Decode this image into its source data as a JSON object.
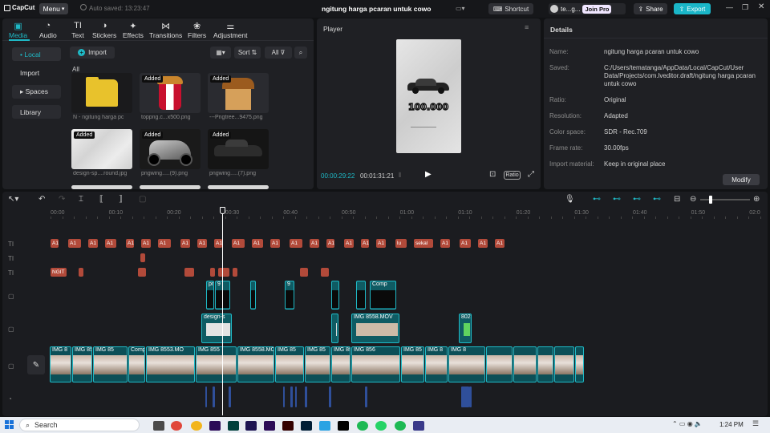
{
  "app": {
    "logo": "CapCut",
    "menu": "Menu",
    "autosave": "Auto saved: 13:23:47",
    "title": "ngitung harga pcaran untuk cowo",
    "shortcut": "Shortcut",
    "user": "te...g...",
    "join_pro": "Join Pro",
    "share": "Share",
    "export": "Export"
  },
  "tabs": [
    {
      "label": "Media",
      "icon": "media-icon"
    },
    {
      "label": "Audio",
      "icon": "audio-icon"
    },
    {
      "label": "Text",
      "icon": "text-icon"
    },
    {
      "label": "Stickers",
      "icon": "stickers-icon"
    },
    {
      "label": "Effects",
      "icon": "effects-icon"
    },
    {
      "label": "Transitions",
      "icon": "transitions-icon"
    },
    {
      "label": "Filters",
      "icon": "filters-icon"
    },
    {
      "label": "Adjustment",
      "icon": "adjustment-icon"
    }
  ],
  "sidebar": [
    "• Local",
    "Import",
    "▸ Spaces",
    "Library"
  ],
  "media_toolbar": {
    "import": "Import",
    "sort": "Sort",
    "all": "All"
  },
  "media_section": "All",
  "media": [
    {
      "caption": "N - ngitung harga pc",
      "added": false,
      "kind": "folder"
    },
    {
      "caption": "toppng.c...x500.png",
      "added": true,
      "kind": "kfc"
    },
    {
      "caption": "---Pngtree...9475.png",
      "added": true,
      "kind": "shop"
    },
    {
      "caption": "design-sp....round.jpg",
      "added": true,
      "kind": "paper"
    },
    {
      "caption": "pngwing.....(9).png",
      "added": true,
      "kind": "bike"
    },
    {
      "caption": "pngwing.....(7).png",
      "added": true,
      "kind": "car"
    }
  ],
  "added_label": "Added",
  "player": {
    "title": "Player",
    "price": "100.000",
    "current": "00:00:29:22",
    "total": "00:01:31:21",
    "ratio": "Ratio"
  },
  "details": {
    "title": "Details",
    "rows": [
      {
        "label": "Name:",
        "value": "ngitung harga pcaran untuk cowo"
      },
      {
        "label": "Saved:",
        "value": "C:/Users/tematanga/AppData/Local/CapCut/User Data/Projects/com.lveditor.draft/ngitung harga pcaran untuk cowo"
      },
      {
        "label": "Ratio:",
        "value": "Original"
      },
      {
        "label": "Resolution:",
        "value": "Adapted"
      },
      {
        "label": "Color space:",
        "value": "SDR - Rec.709"
      },
      {
        "label": "Frame rate:",
        "value": "30.00fps"
      },
      {
        "label": "Import material:",
        "value": "Keep in original place"
      }
    ],
    "modify": "Modify"
  },
  "ruler": [
    "00:00",
    "00:10",
    "00:20",
    "00:30",
    "00:40",
    "00:50",
    "01:00",
    "01:10",
    "01:20",
    "01:30",
    "01:40",
    "01:50",
    "02:0"
  ],
  "video_labels": [
    "IMG 8",
    "IMG 855",
    "IMG 85",
    "Compound cl",
    "IMG 8553.MO",
    "IMG 855",
    "IMG 8558.MOV",
    "IMG 85",
    "IMG 85",
    "IMG 8561.MO",
    "IMG 856",
    "IMG 85",
    "IMG 8",
    "IMG 8"
  ],
  "overlay_labels": [
    "design-s",
    "IMG 8558.MOV",
    "802",
    "pr",
    "png",
    "9",
    "Comp"
  ],
  "text_clips": [
    "A1",
    "A1",
    "A1",
    "A1",
    "A1",
    "A1",
    "A1",
    "A1",
    "A1",
    "A1",
    "A1",
    "A1",
    "A1",
    "A1",
    "A1",
    "A1",
    "A1",
    "A1",
    "A1",
    "lu",
    "sekal",
    "A1",
    "A1",
    "A1",
    "A1"
  ],
  "text_red_label": "NGIT",
  "taskbar": {
    "search": "Search",
    "time": "1:24 PM"
  },
  "colors": {
    "accent": "#1fb9c6",
    "export": "#1ab6c8",
    "text_clip": "#b24a3a",
    "video_clip": "#0f5b63"
  }
}
